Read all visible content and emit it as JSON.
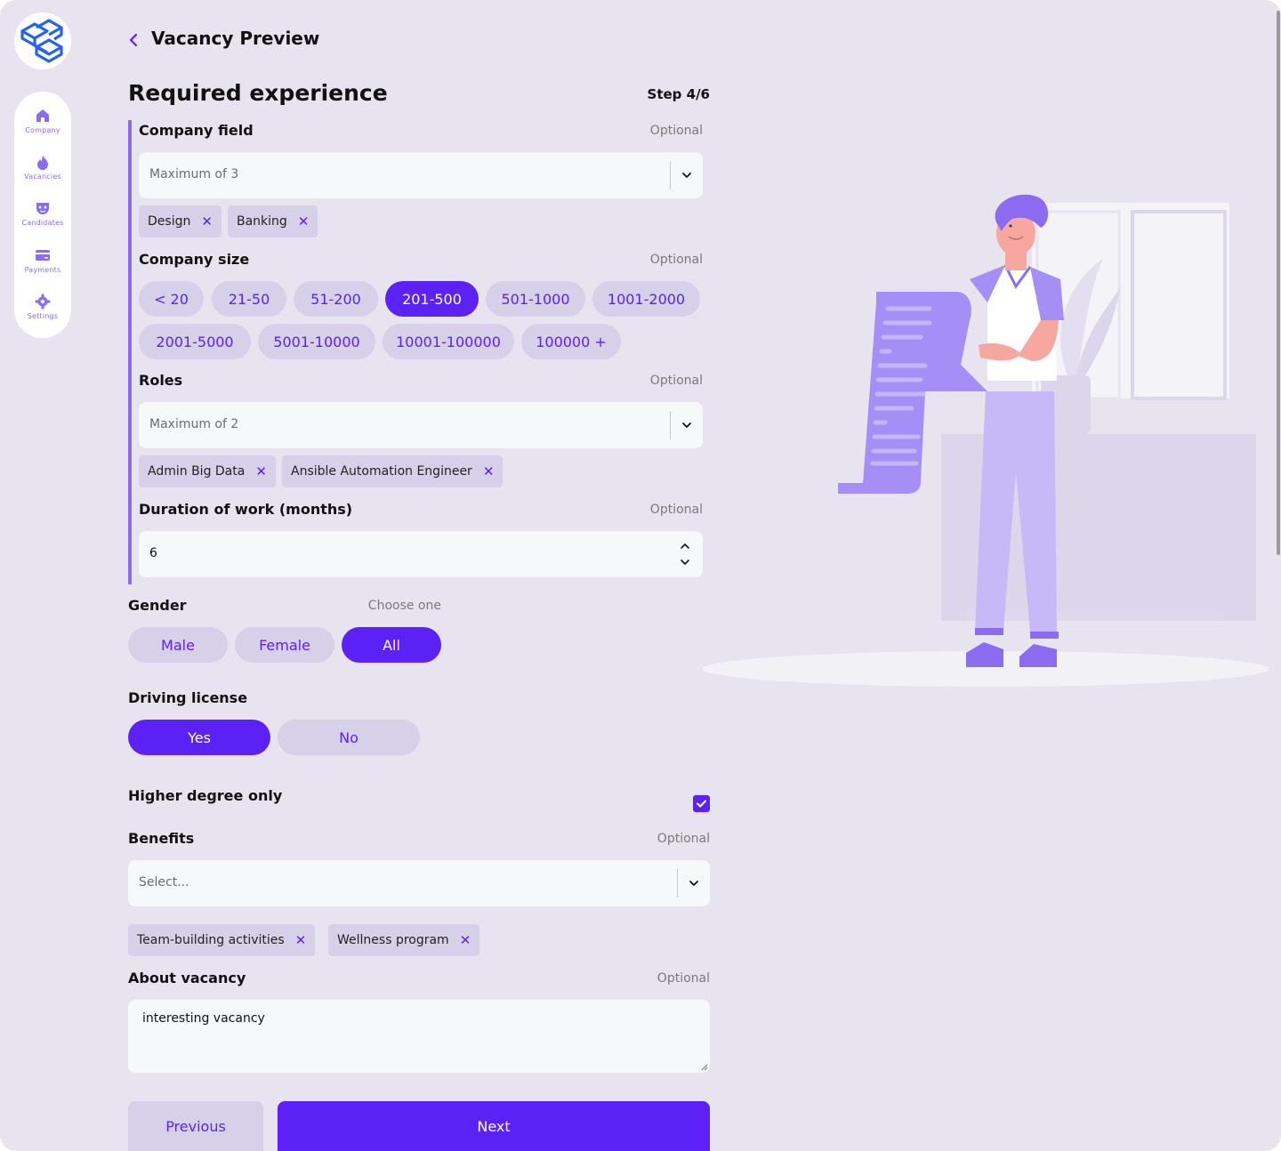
{
  "sidebar": {
    "items": [
      {
        "label": "Company",
        "icon": "home-icon"
      },
      {
        "label": "Vacancies",
        "icon": "fire-icon"
      },
      {
        "label": "Candidates",
        "icon": "mask-icon"
      },
      {
        "label": "Payments",
        "icon": "card-icon"
      },
      {
        "label": "Settings",
        "icon": "gear-icon"
      }
    ]
  },
  "header": {
    "title": "Vacancy Preview"
  },
  "section": {
    "title": "Required experience",
    "step": "Step 4/6"
  },
  "company_field": {
    "label": "Company field",
    "optional": "Optional",
    "placeholder": "Maximum of 3",
    "tags": [
      "Design",
      "Banking"
    ]
  },
  "company_size": {
    "label": "Company size",
    "optional": "Optional",
    "options": [
      "< 20",
      "21-50",
      "51-200",
      "201-500",
      "501-1000",
      "1001-2000",
      "2001-5000",
      "5001-10000",
      "10001-100000",
      "100000 +"
    ],
    "selected": "201-500"
  },
  "roles": {
    "label": "Roles",
    "optional": "Optional",
    "placeholder": "Maximum of 2",
    "tags": [
      "Admin Big Data",
      "Ansible Automation Engineer"
    ]
  },
  "duration": {
    "label": "Duration of work (months)",
    "optional": "Optional",
    "value": "6"
  },
  "gender": {
    "label": "Gender",
    "hint": "Choose one",
    "options": [
      "Male",
      "Female",
      "All"
    ],
    "selected": "All"
  },
  "driving": {
    "label": "Driving license",
    "options": [
      "Yes",
      "No"
    ],
    "selected": "Yes"
  },
  "higher_degree": {
    "label": "Higher degree only",
    "checked": true
  },
  "benefits": {
    "label": "Benefits",
    "optional": "Optional",
    "placeholder": "Select...",
    "tags": [
      "Team-building activities",
      "Wellness program"
    ]
  },
  "about": {
    "label": "About vacancy",
    "optional": "Optional",
    "value": "interesting vacancy"
  },
  "actions": {
    "previous": "Previous",
    "next": "Next"
  },
  "colors": {
    "accent": "#5b21f5",
    "soft": "#d6d0e8",
    "bg": "#e7e4ef",
    "illustration": "#8b6cf0"
  }
}
